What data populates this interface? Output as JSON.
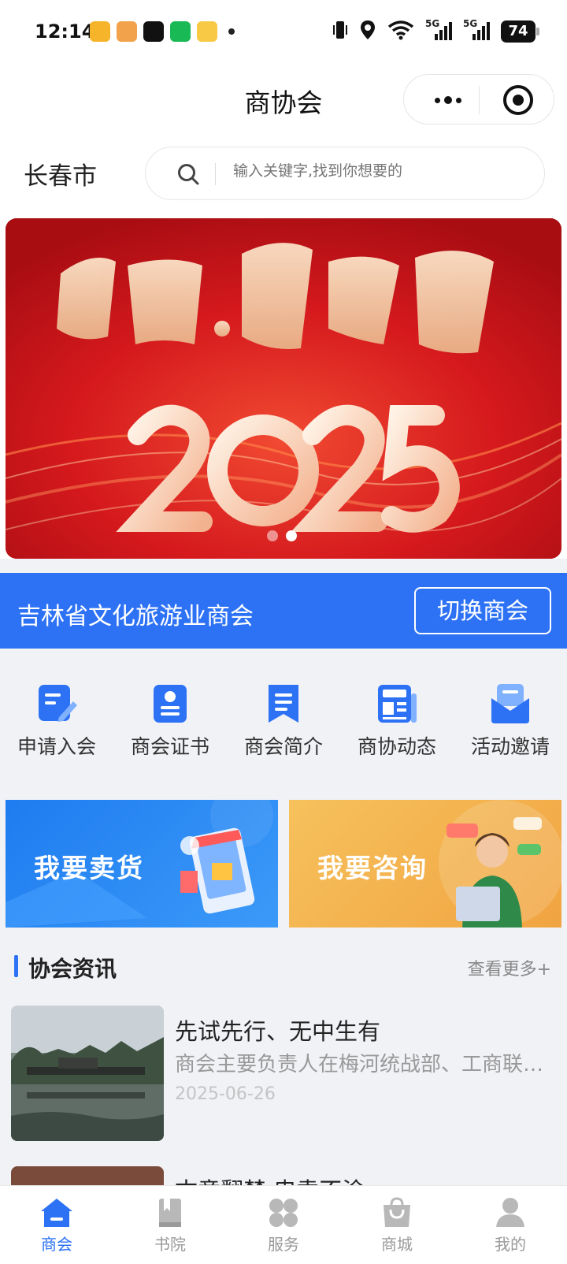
{
  "status_bar": {
    "time": "12:14",
    "battery": "74",
    "signal_label": "5G"
  },
  "nav": {
    "title": "商协会"
  },
  "location": {
    "city": "长春市"
  },
  "search": {
    "placeholder": "输入关键字,找到你想要的"
  },
  "banner": {
    "calligraphy_icon": "banner-calligraphy",
    "slide_count": 2,
    "active_slide": 2
  },
  "chamber": {
    "name": "吉林省文化旅游业商会",
    "switch_label": "切换商会"
  },
  "menu": [
    {
      "label": "申请入会",
      "icon": "edit-icon"
    },
    {
      "label": "商会证书",
      "icon": "certificate-icon"
    },
    {
      "label": "商会简介",
      "icon": "bookmark-doc-icon"
    },
    {
      "label": "商协动态",
      "icon": "news-icon"
    },
    {
      "label": "活动邀请",
      "icon": "invitation-icon"
    }
  ],
  "promos": {
    "sell_label": "我要卖货",
    "ask_label": "我要咨询"
  },
  "news_section": {
    "title": "协会资讯",
    "more": "查看更多+"
  },
  "news": [
    {
      "title": "先试先行、无中生有",
      "desc": "商会主要负责人在梅河统战部、工商联座谈交流",
      "date": "2025-06-26"
    },
    {
      "title": "古意翻禁 忠袁不涂",
      "desc": "",
      "date": ""
    }
  ],
  "tabs": [
    {
      "label": "商会",
      "icon": "home-icon",
      "active": true
    },
    {
      "label": "书院",
      "icon": "book-icon",
      "active": false
    },
    {
      "label": "服务",
      "icon": "grid-icon",
      "active": false
    },
    {
      "label": "商城",
      "icon": "shopping-bag-icon",
      "active": false
    },
    {
      "label": "我的",
      "icon": "user-icon",
      "active": false
    }
  ],
  "colors": {
    "accent": "#2d72f5",
    "banner_red": "#c4141c",
    "promo_blue": "#1f7cf0",
    "promo_orange": "#f1a441"
  }
}
